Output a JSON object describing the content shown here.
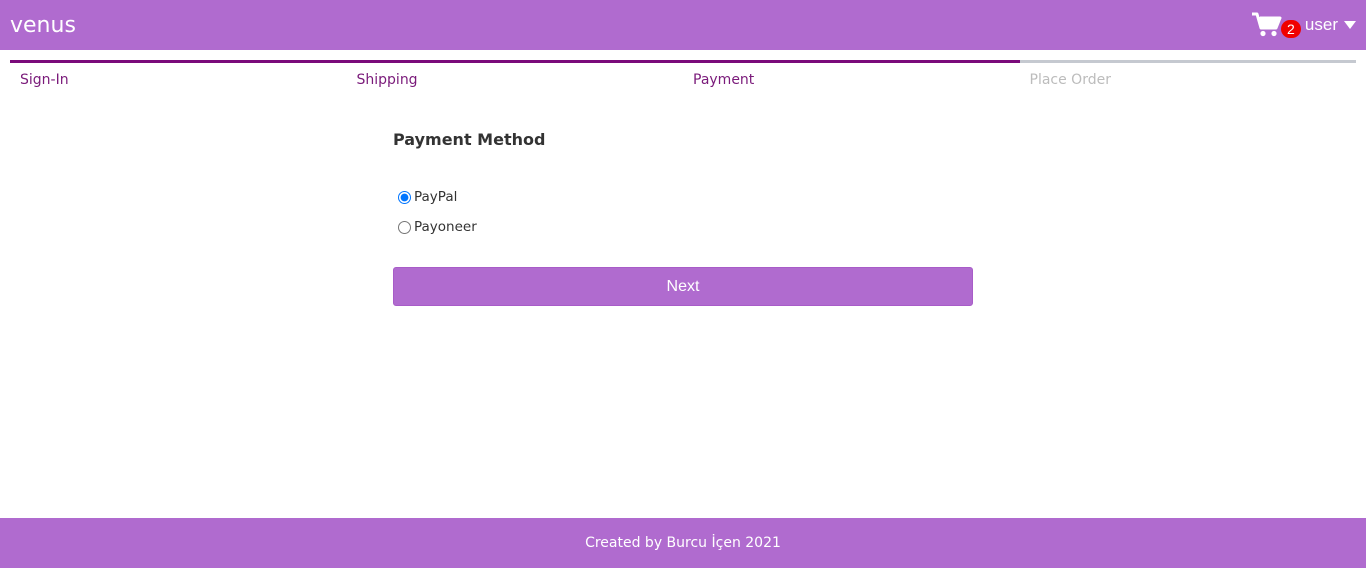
{
  "header": {
    "brand": "venus",
    "cart_count": "2",
    "user_label": "user"
  },
  "steps": [
    {
      "label": "Sign-In",
      "active": true
    },
    {
      "label": "Shipping",
      "active": true
    },
    {
      "label": "Payment",
      "active": true
    },
    {
      "label": "Place Order",
      "active": false
    }
  ],
  "payment": {
    "title": "Payment Method",
    "options": [
      {
        "label": "PayPal",
        "selected": true
      },
      {
        "label": "Payoneer",
        "selected": false
      }
    ],
    "next_label": "Next"
  },
  "footer": {
    "text": "Created by Burcu İçen 2021"
  },
  "colors": {
    "brand": "#b06bcf",
    "step_active": "#7a0a7a",
    "step_inactive": "#c5c9d0",
    "badge": "#f00000"
  }
}
